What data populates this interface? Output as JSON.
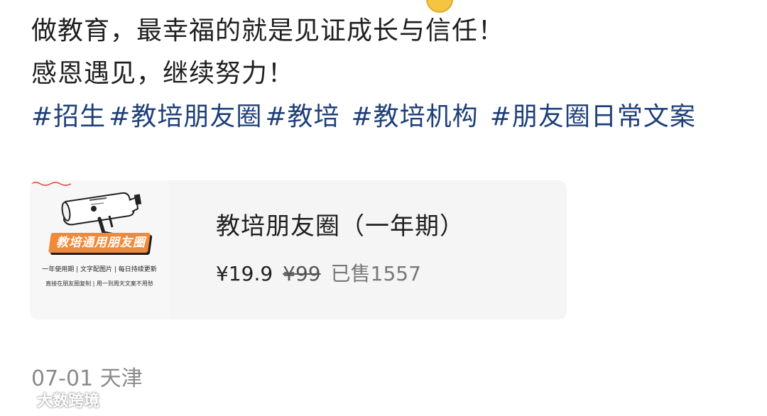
{
  "post": {
    "line1": "做教育，最幸福的就是见证成长与信任！",
    "line2": "感恩遇见，继续努力！",
    "tags": [
      "#招生",
      "#教培朋友圈",
      "#教培",
      "#教培机构",
      "#朋友圈日常文案"
    ]
  },
  "product_card": {
    "thumbnail": {
      "badge_text": "教培通用朋友圈",
      "subtitle": "一年使用期 | 文字配图片 | 每日持续更新",
      "note": "直接在朋友圈复制 | 用一到周天文案不用愁"
    },
    "title": "教培朋友圈（一年期）",
    "price": "¥19.9",
    "original_price": "¥99",
    "sold": "已售1557"
  },
  "meta": {
    "date": "07-01",
    "location": "天津"
  },
  "watermark": {
    "text": "大数跨境"
  },
  "colors": {
    "tag_blue": "#1e3f7a",
    "card_bg": "#f5f5f5",
    "badge_orange": "#f08a3a",
    "meta_gray": "#8a8a8a"
  }
}
